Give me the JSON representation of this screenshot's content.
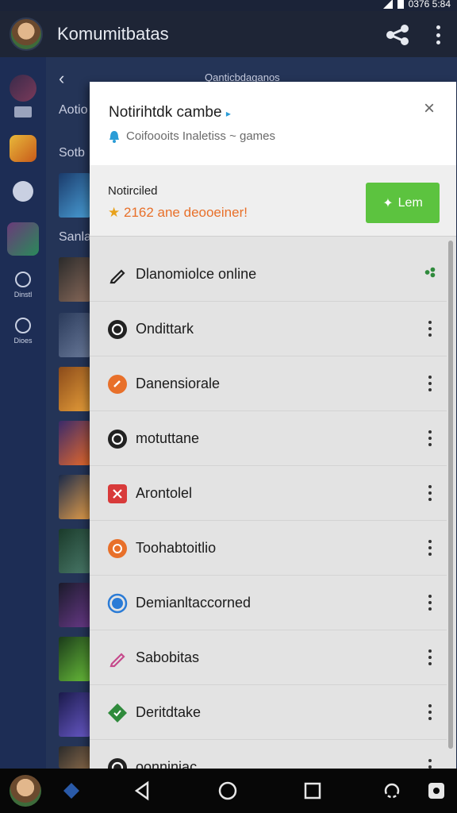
{
  "status": {
    "text": "0376 5:84"
  },
  "app": {
    "title": "Komumitbatas"
  },
  "background": {
    "top_text": "Qanticbdaganos",
    "label_1": "Aotio",
    "label_2": "Sotb",
    "label_3": "Sanla"
  },
  "rail": {
    "label_1": "Dinstl",
    "label_2": "Dioes"
  },
  "panel": {
    "title": "Notirihtdk cambe",
    "subtitle": "Coifoooits Inaletiss ~ games",
    "notification": {
      "label": "Notirciled",
      "text": "2162 ane deooeiner!",
      "button_label": "Lem"
    },
    "items": [
      {
        "label": "Dlanomiolce online",
        "icon": "pencil-icon",
        "color": "#222222"
      },
      {
        "label": "Ondittark",
        "icon": "refresh-icon",
        "color": "#222222"
      },
      {
        "label": "Danensiorale",
        "icon": "link-icon",
        "color": "#e8702a"
      },
      {
        "label": "motuttane",
        "icon": "refresh-icon",
        "color": "#222222"
      },
      {
        "label": "Arontolel",
        "icon": "tag-icon",
        "color": "#d83a3a"
      },
      {
        "label": "Toohabtoitlio",
        "icon": "heart-icon",
        "color": "#e8702a"
      },
      {
        "label": "Demianltaccorned",
        "icon": "circle-icon",
        "color": "#2a7bd6"
      },
      {
        "label": "Sabobitas",
        "icon": "pencil-icon",
        "color": "#c64a8c"
      },
      {
        "label": "Deritdtake",
        "icon": "diamond-icon",
        "color": "#2f8a3c"
      },
      {
        "label": "oonniniac",
        "icon": "refresh-icon",
        "color": "#222222"
      }
    ]
  },
  "colors": {
    "accent_green": "#5cc33f",
    "accent_orange": "#e8702a",
    "background_navy": "#1d2d55"
  }
}
